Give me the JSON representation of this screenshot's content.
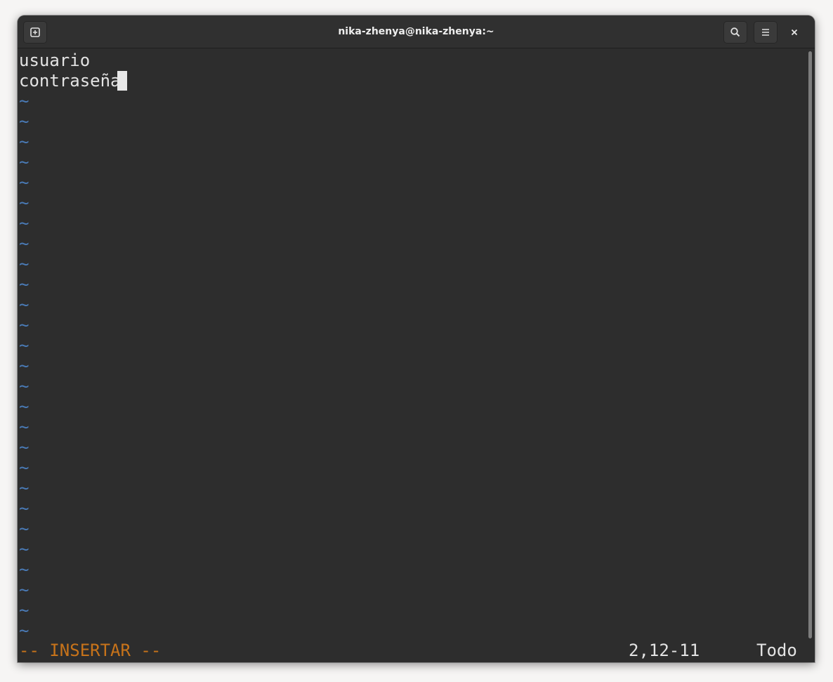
{
  "window": {
    "title": "nika-zhenya@nika-zhenya:~"
  },
  "titlebar": {
    "new_tab_icon": "new-tab-icon",
    "search_icon": "search-icon",
    "menu_icon": "hamburger-menu-icon",
    "close_icon": "close-icon"
  },
  "editor": {
    "lines": [
      "usuario",
      "contraseña"
    ],
    "empty_line_marker": "~",
    "empty_line_count": 27
  },
  "statusbar": {
    "mode": "-- INSERTAR --",
    "position": "2,12-11",
    "scroll": "Todo"
  },
  "colors": {
    "background": "#2d2d2d",
    "text": "#e3e3e3",
    "tilde": "#4a7bb7",
    "mode": "#c7731a"
  }
}
